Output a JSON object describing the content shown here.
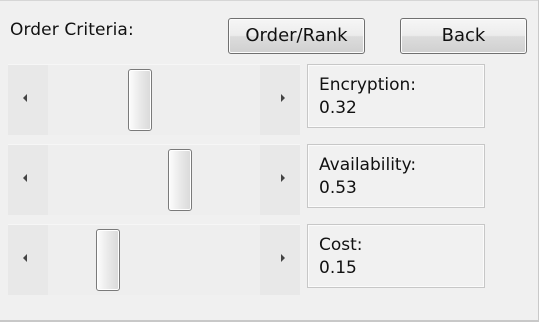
{
  "header": {
    "order_criteria_label": "Order Criteria:"
  },
  "buttons": {
    "order_rank": "Order/Rank",
    "back": "Back"
  },
  "criteria": [
    {
      "label": "Encryption:",
      "value": "0.32",
      "level": 0.32
    },
    {
      "label": "Availability:",
      "value": "0.53",
      "level": 0.53
    },
    {
      "label": "Cost:",
      "value": "0.15",
      "level": 0.15
    }
  ],
  "icons": {
    "left": "arrow-left-icon",
    "right": "arrow-right-icon"
  }
}
